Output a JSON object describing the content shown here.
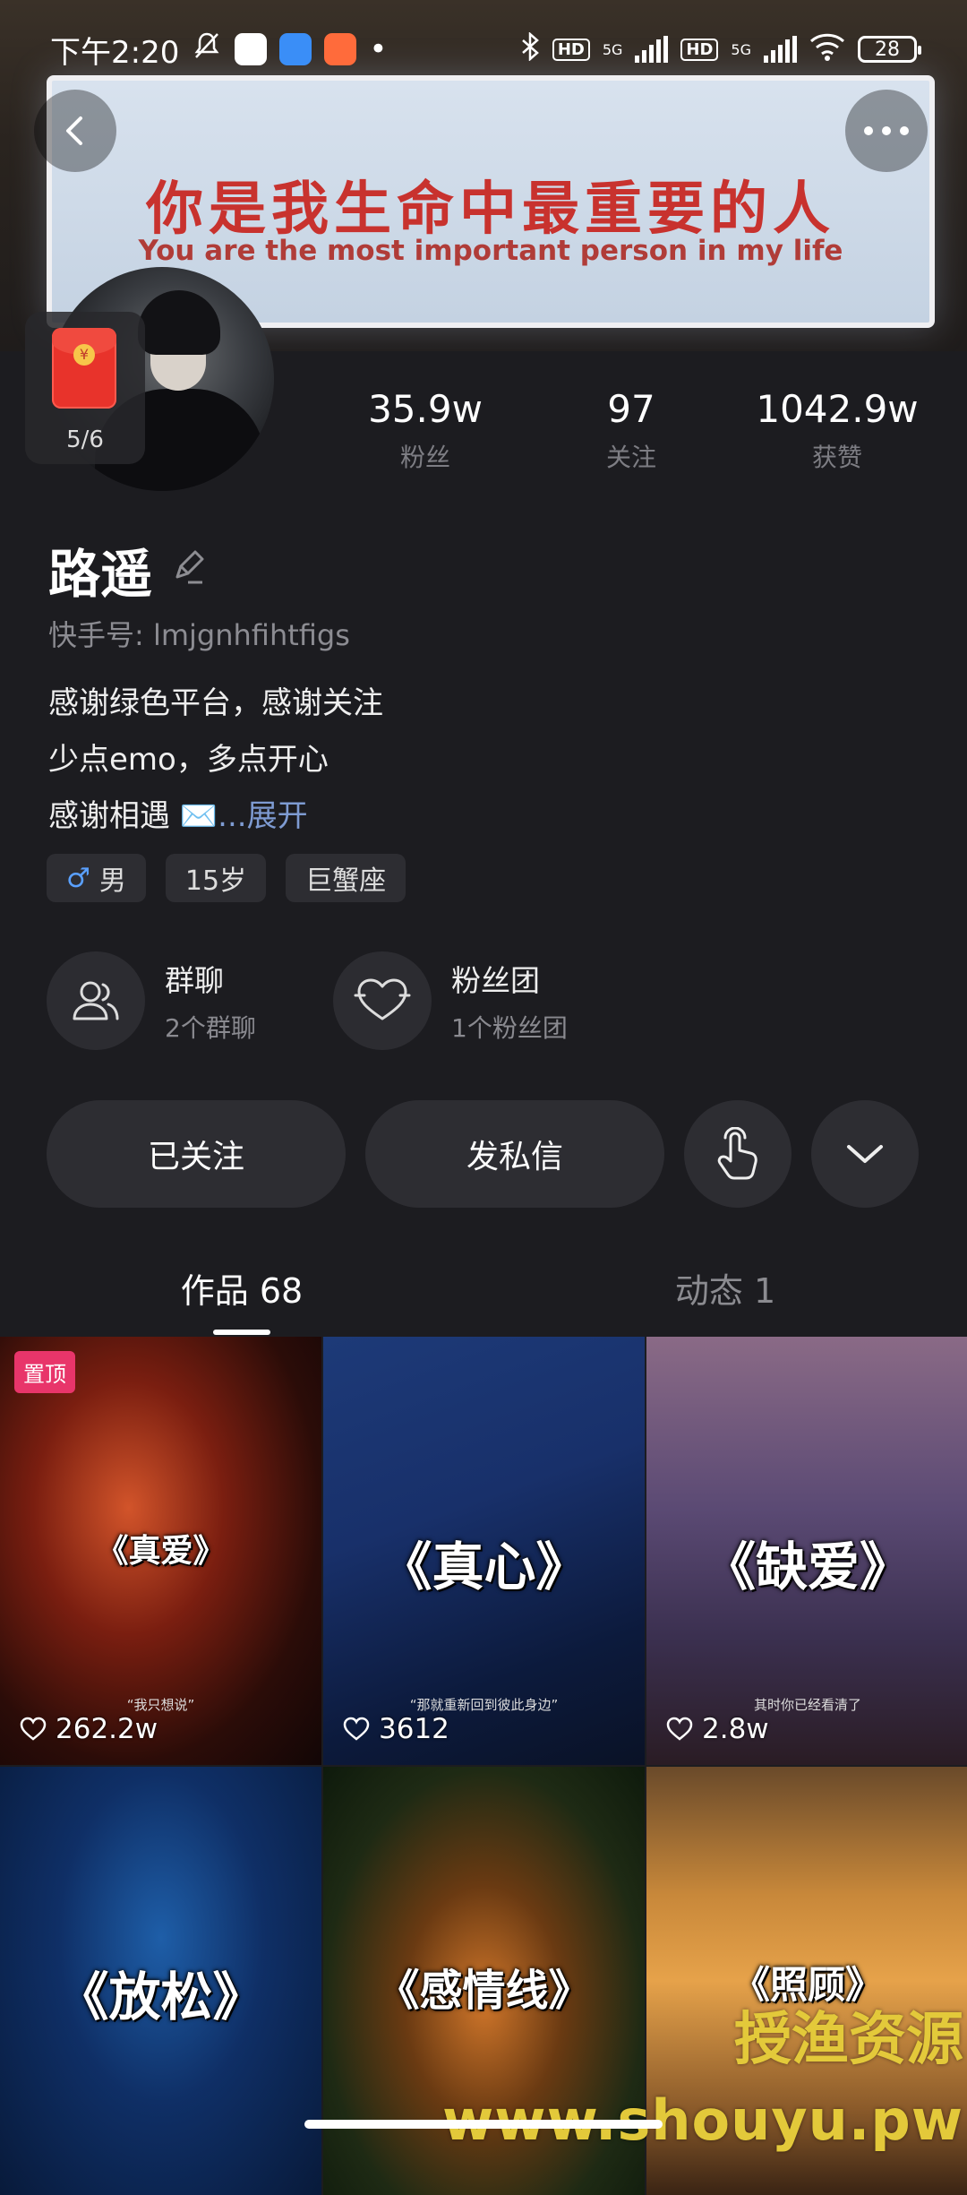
{
  "status_bar": {
    "time": "下午2:20",
    "battery": "28",
    "network_1": "5G",
    "network_2": "5G",
    "hd_1": "HD",
    "hd_2": "HD"
  },
  "banner": {
    "text_zh": "你是我生命中最重要的人",
    "text_en": "You are the most important person in my life"
  },
  "red_packet": {
    "count": "5/6"
  },
  "stats": [
    {
      "value": "35.9w",
      "label": "粉丝"
    },
    {
      "value": "97",
      "label": "关注"
    },
    {
      "value": "1042.9w",
      "label": "获赞"
    }
  ],
  "profile": {
    "name": "路遥",
    "user_id": "快手号: lmjgnhfihtfigs",
    "bio_line1": "感谢绿色平台，感谢关注",
    "bio_line2": "少点emo，多点开心",
    "bio_line3": "感谢相遇 ✉️",
    "bio_more": "...展开"
  },
  "tags": [
    {
      "icon": "male-icon",
      "label": "男"
    },
    {
      "label": "15岁"
    },
    {
      "label": "巨蟹座"
    }
  ],
  "groups": [
    {
      "icon": "users-icon",
      "title": "群聊",
      "subtitle": "2个群聊"
    },
    {
      "icon": "heart-icon",
      "title": "粉丝团",
      "subtitle": "1个粉丝团"
    }
  ],
  "actions": {
    "follow_label": "已关注",
    "message_label": "发私信"
  },
  "tabs": [
    {
      "label": "作品 68",
      "active": true
    },
    {
      "label": "动态 1",
      "active": false
    }
  ],
  "videos": [
    {
      "title": "《真爱》",
      "caption": "“我只想说”",
      "likes": "262.2w",
      "pinned": "置顶"
    },
    {
      "title": "《真心》",
      "caption": "“那就重新回到彼此身边”",
      "likes": "3612"
    },
    {
      "title": "《缺爱》",
      "caption": "其时你已经看清了",
      "likes": "2.8w"
    },
    {
      "title": "《放松》"
    },
    {
      "title": "《感情线》"
    },
    {
      "title": "《照顾》"
    }
  ],
  "watermark": {
    "line1": "授渔资源",
    "line2": "www.shouyu.pw"
  }
}
